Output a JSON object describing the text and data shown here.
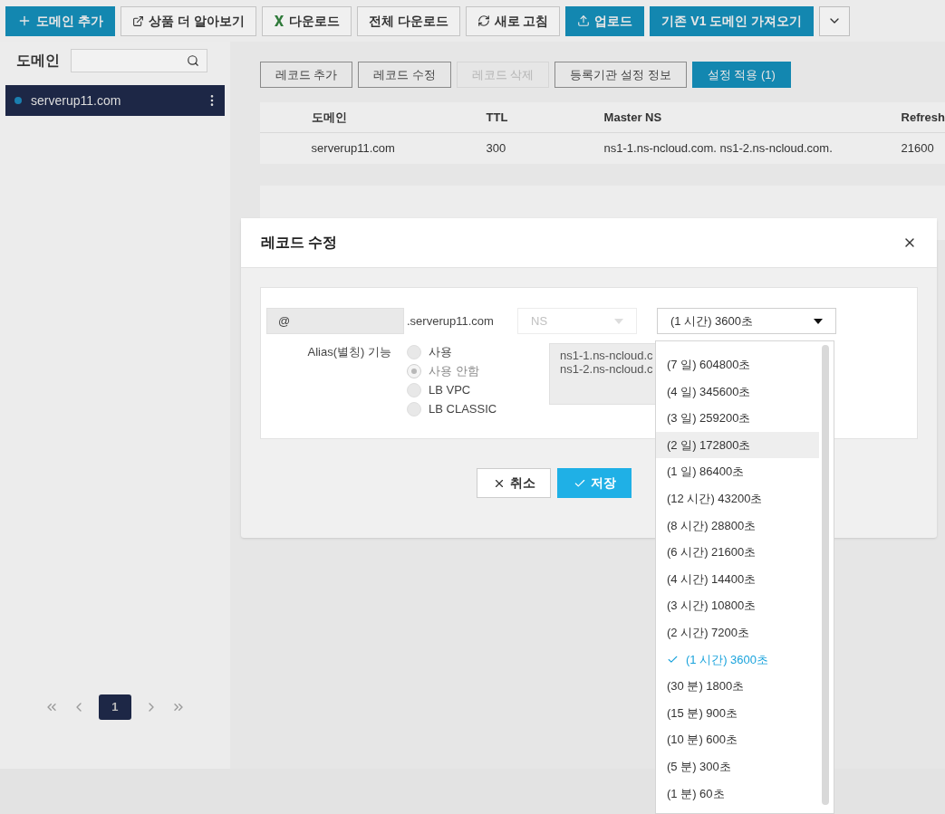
{
  "toolbar": [
    {
      "kind": "add",
      "label": "도메인 추가",
      "primary": true
    },
    {
      "kind": "external",
      "label": "상품 더 알아보기",
      "primary": false
    },
    {
      "kind": "excel",
      "label": "다운로드",
      "primary": false
    },
    {
      "kind": "plain",
      "label": "전체 다운로드",
      "primary": false
    },
    {
      "kind": "refresh",
      "label": "새로 고침",
      "primary": false
    },
    {
      "kind": "upload",
      "label": "업로드",
      "primary": true
    },
    {
      "kind": "plain",
      "label": "기존 V1 도메인 가져오기",
      "primary": true
    },
    {
      "kind": "more",
      "primary": false
    }
  ],
  "sidebar": {
    "title": "도메인",
    "items": [
      {
        "label": "serverup11.com",
        "selected": true
      }
    ],
    "pagination": {
      "pages": [
        {
          "label": "1",
          "selected": true
        }
      ]
    }
  },
  "actions": [
    {
      "label": "레코드 추가",
      "disabled": false,
      "primary": false
    },
    {
      "label": "레코드 수정",
      "disabled": false,
      "primary": false
    },
    {
      "label": "레코드 삭제",
      "disabled": true,
      "primary": false
    },
    {
      "label": "등록기관 설정 정보",
      "disabled": false,
      "primary": false
    },
    {
      "label": "설정 적용 (1)",
      "disabled": false,
      "primary": true
    }
  ],
  "domain_table": {
    "columns": [
      "도메인",
      "TTL",
      "Master NS",
      "Refresh"
    ],
    "rows": [
      [
        "serverup11.com",
        "300",
        "ns1-1.ns-ncloud.com. ns1-2.ns-ncloud.com.",
        "21600"
      ]
    ]
  },
  "dialog": {
    "title": "레코드 수정",
    "host": {
      "value": "@"
    },
    "domain_suffix": ".serverup11.com",
    "type_select": {
      "value": "NS",
      "disabled": true
    },
    "ttl_select": {
      "value": "(1 시간) 3600초",
      "expanded": true
    },
    "alias_label": "Alias(별칭) 기능",
    "alias_options": [
      {
        "label": "사용",
        "selected": false
      },
      {
        "label": "사용 안함",
        "selected": true
      },
      {
        "label": "LB VPC",
        "selected": false
      },
      {
        "label": "LB CLASSIC",
        "selected": false
      }
    ],
    "record_value": [
      "ns1-1.ns-ncloud.c",
      "ns1-2.ns-ncloud.c"
    ],
    "buttons": [
      {
        "kind": "cancel",
        "label": "취소"
      },
      {
        "kind": "save",
        "label": "저장"
      }
    ],
    "ttl_options": [
      {
        "label": "(7 일) 604800초",
        "selected": false,
        "highlighted": false
      },
      {
        "label": "(4 일) 345600초",
        "selected": false,
        "highlighted": false
      },
      {
        "label": "(3 일) 259200초",
        "selected": false,
        "highlighted": false
      },
      {
        "label": "(2 일) 172800초",
        "selected": false,
        "highlighted": true
      },
      {
        "label": "(1 일) 86400초",
        "selected": false,
        "highlighted": false
      },
      {
        "label": "(12 시간) 43200초",
        "selected": false,
        "highlighted": false
      },
      {
        "label": "(8 시간) 28800초",
        "selected": false,
        "highlighted": false
      },
      {
        "label": "(6 시간) 21600초",
        "selected": false,
        "highlighted": false
      },
      {
        "label": "(4 시간) 14400초",
        "selected": false,
        "highlighted": false
      },
      {
        "label": "(3 시간) 10800초",
        "selected": false,
        "highlighted": false
      },
      {
        "label": "(2 시간) 7200초",
        "selected": false,
        "highlighted": false
      },
      {
        "label": "(1 시간) 3600초",
        "selected": true,
        "highlighted": false
      },
      {
        "label": "(30 분) 1800초",
        "selected": false,
        "highlighted": false
      },
      {
        "label": "(15 분) 900초",
        "selected": false,
        "highlighted": false
      },
      {
        "label": "(10 분) 600초",
        "selected": false,
        "highlighted": false
      },
      {
        "label": "(5 분) 300초",
        "selected": false,
        "highlighted": false
      },
      {
        "label": "(1 분) 60초",
        "selected": false,
        "highlighted": false
      }
    ]
  }
}
